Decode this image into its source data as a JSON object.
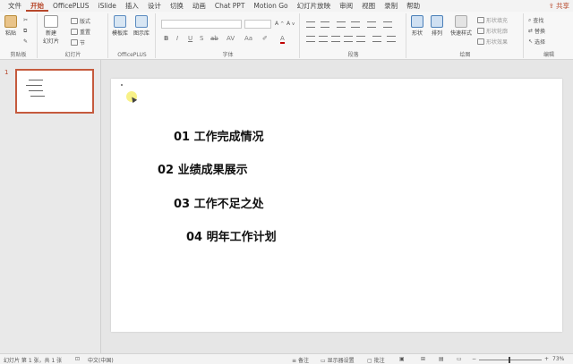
{
  "menu": {
    "tabs": [
      "文件",
      "开始",
      "OfficePLUS",
      "iSlide",
      "插入",
      "设计",
      "切换",
      "动画",
      "Chat PPT",
      "Motion Go",
      "幻灯片放映",
      "审阅",
      "视图",
      "录制",
      "帮助"
    ],
    "active_index": 1,
    "share_label": "共享"
  },
  "ribbon": {
    "clipboard": {
      "paste": "粘贴",
      "label": "剪贴板"
    },
    "slides": {
      "new_slide": "新建",
      "new_slide2": "幻灯片",
      "layout": "版式",
      "reset": "重置",
      "section": "节",
      "label": "幻灯片"
    },
    "officeplus": {
      "template": "模板库",
      "ppt": "图示库",
      "label": "OfficePLUS"
    },
    "font": {
      "label": "字体",
      "bold": "B",
      "italic": "I",
      "underline": "U",
      "shadow": "S",
      "strike": "ab",
      "spacing": "AV",
      "case": "Aa",
      "color": "A"
    },
    "paragraph": {
      "label": "段落"
    },
    "drawing": {
      "shape": "形状",
      "arrange": "排列",
      "quick_style": "快速样式",
      "fill": "形状填充",
      "outline": "形状轮廓",
      "effect": "形状效果",
      "label": "绘图"
    },
    "editing": {
      "find": "查找",
      "replace": "替换",
      "select": "选择",
      "label": "编辑"
    }
  },
  "thumbnails": {
    "slide_number": "1"
  },
  "slide": {
    "items": [
      "01 工作完成情况",
      "02 业绩成果展示",
      "03 工作不足之处",
      "04 明年工作计划"
    ]
  },
  "status": {
    "slide_info": "幻灯片 第 1 张，共 1 张",
    "language": "中文(中国)",
    "notes": "备注",
    "display_settings": "显示器设置",
    "comments": "批注",
    "zoom": "73%"
  },
  "colors": {
    "accent": "#b7472a"
  }
}
